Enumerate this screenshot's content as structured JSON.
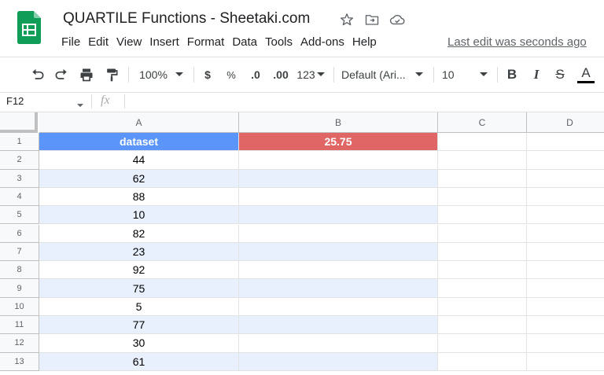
{
  "app": {
    "title": "QUARTILE Functions - Sheetaki.com",
    "menus": [
      "File",
      "Edit",
      "View",
      "Insert",
      "Format",
      "Data",
      "Tools",
      "Add-ons",
      "Help"
    ],
    "last_edit": "Last edit was seconds ago"
  },
  "toolbar": {
    "zoom": "100%",
    "currency": "$",
    "percent": "%",
    "decrease_decimal": ".0",
    "increase_decimal": ".00",
    "more_formats": "123",
    "font": "Default (Ari...",
    "font_size": "10",
    "bold": "B",
    "italic": "I",
    "strike": "S",
    "text_color": "A"
  },
  "formula_bar": {
    "name_box": "F12",
    "fx": "fx",
    "value": ""
  },
  "grid": {
    "columns": [
      "A",
      "B",
      "C",
      "D"
    ],
    "rows": [
      "1",
      "2",
      "3",
      "4",
      "5",
      "6",
      "7",
      "8",
      "9",
      "10",
      "11",
      "12",
      "13"
    ],
    "cells": {
      "A": [
        "dataset",
        "44",
        "62",
        "88",
        "10",
        "82",
        "23",
        "92",
        "75",
        "5",
        "77",
        "30",
        "61"
      ],
      "B": [
        "25.75",
        "",
        "",
        "",
        "",
        "",
        "",
        "",
        "",
        "",
        "",
        "",
        ""
      ]
    }
  },
  "colors": {
    "header_a": "#5b95f9",
    "header_b": "#e06666",
    "band": "#e8f0fe",
    "accent": "#1a73e8"
  }
}
